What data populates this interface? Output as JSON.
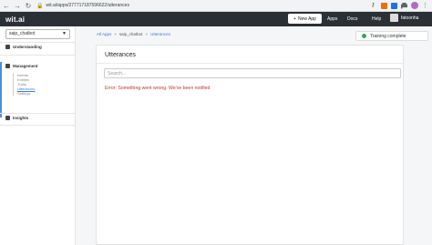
{
  "browser": {
    "url": "wit.ai/apps/277717187596622/utterances",
    "back_icon": "back-arrow-icon",
    "forward_icon": "forward-arrow-icon",
    "reload_icon": "reload-icon"
  },
  "header": {
    "logo": "wit.ai",
    "new_app_label": "New App",
    "new_app_icon": "+",
    "nav": [
      "Apps",
      "Docs",
      "Help"
    ],
    "user_name": "fatoonha"
  },
  "sidebar": {
    "app_selected": "saip_chatbot",
    "understanding_label": "Understanding",
    "management_label": "Management",
    "management_items": [
      {
        "label": "Intents",
        "active": false
      },
      {
        "label": "Entities",
        "active": false
      },
      {
        "label": "Traits",
        "active": false
      },
      {
        "label": "Utterances",
        "active": true
      },
      {
        "label": "Settings",
        "active": false
      }
    ],
    "insights_label": "Insights"
  },
  "breadcrumb": {
    "items": [
      "All Apps",
      "saip_chatbot",
      "Utterances"
    ],
    "separator": ">"
  },
  "status": {
    "training_label": "Training complete",
    "color": "#34a853"
  },
  "panel": {
    "title": "Utterances",
    "search_placeholder": "Search...",
    "error": "Error: Something went wrong. We've been notified"
  },
  "colors": {
    "header_bg": "#2b2f36",
    "accent": "#3b7bd4",
    "error": "#c0392b"
  }
}
